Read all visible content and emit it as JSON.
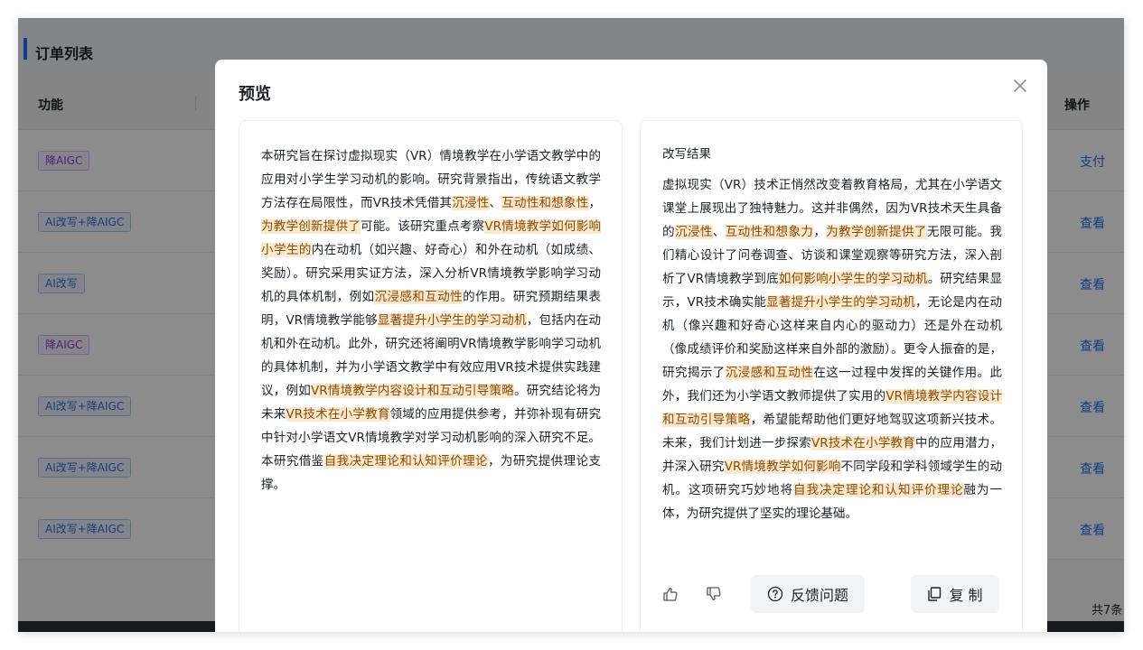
{
  "app": {
    "title": "订单列表",
    "columns": {
      "function": "功能",
      "operation": "操作"
    },
    "rows": [
      {
        "tag": "降AIGC",
        "tag_color": "purple",
        "action": "支付"
      },
      {
        "tag": "AI改写+降AIGC",
        "tag_color": "blue",
        "action": "查看"
      },
      {
        "tag": "AI改写",
        "tag_color": "blue",
        "action": "查看"
      },
      {
        "tag": "降AIGC",
        "tag_color": "purple",
        "action": "查看"
      },
      {
        "tag": "AI改写+降AIGC",
        "tag_color": "blue",
        "action": "查看"
      },
      {
        "tag": "AI改写+降AIGC",
        "tag_color": "blue",
        "action": "查看"
      },
      {
        "tag": "AI改写+降AIGC",
        "tag_color": "blue",
        "action": "查看"
      }
    ],
    "total_text": "共7条"
  },
  "modal": {
    "title": "预览",
    "original_segments": [
      {
        "t": "本研究旨在探讨虚拟现实（VR）情境教学在小学语文教学中的应用对小学生学习动机的影响。研究背景指出，传统语文教学方法存在局限性，而VR技术凭借其",
        "h": false
      },
      {
        "t": "沉浸性",
        "h": true
      },
      {
        "t": "、",
        "h": false
      },
      {
        "t": "互动性和想象性",
        "h": true
      },
      {
        "t": "，",
        "h": false
      },
      {
        "t": "为教学创新提供了",
        "h": true
      },
      {
        "t": "可能。该研究重点考察",
        "h": false
      },
      {
        "t": "VR情境教学如何影响小学生的",
        "h": true
      },
      {
        "t": "内在动机（如兴趣、好奇心）和外在动机（如成绩、奖励）。研究采用实证方法，深入分析VR情境教学影响学习动机的具体机制，例如",
        "h": false
      },
      {
        "t": "沉浸感和互动性",
        "h": true
      },
      {
        "t": "的作用。研究预期结果表明，VR情境教学能够",
        "h": false
      },
      {
        "t": "显著提升小学生的学习动机",
        "h": true
      },
      {
        "t": "，包括内在动机和外在动机。此外，研究还将阐明VR情境教学影响学习动机的具体机制，并为小学语文教学中有效应用VR技术提供实践建议，例如",
        "h": false
      },
      {
        "t": "VR情境教学内容设计和互动引导策略",
        "h": true
      },
      {
        "t": "。研究结论将为未来",
        "h": false
      },
      {
        "t": "VR技术在小学教育",
        "h": true
      },
      {
        "t": "领域的应用提供参考，并弥补现有研究中针对小学语文VR情境教学对学习动机影响的深入研究不足。本研究借鉴",
        "h": false
      },
      {
        "t": "自我决定理论和认知评价理论",
        "h": true
      },
      {
        "t": "，为研究提供理论支撑。",
        "h": false
      }
    ],
    "result_label": "改写结果",
    "rewritten_segments": [
      {
        "t": "虚拟现实（VR）技术正悄然改变着教育格局，尤其在小学语文课堂上展现出了独特魅力。这并非偶然，因为VR技术天生具备的",
        "h": false
      },
      {
        "t": "沉浸性",
        "h": true
      },
      {
        "t": "、",
        "h": false
      },
      {
        "t": "互动性和想象力",
        "h": true
      },
      {
        "t": "，",
        "h": false
      },
      {
        "t": "为教学创新提供了",
        "h": true
      },
      {
        "t": "无限可能。我们精心设计了问卷调查、访谈和课堂观察等研究方法，深入剖析了VR情境教学到底",
        "h": false
      },
      {
        "t": "如何影响小学生的学习动机",
        "h": true
      },
      {
        "t": "。研究结果显示，VR技术确实能",
        "h": false
      },
      {
        "t": "显著提升小学生的学习动机",
        "h": true
      },
      {
        "t": "，无论是内在动机（像兴趣和好奇心这样来自内心的驱动力）还是外在动机（像成绩评价和奖励这样来自外部的激励）。更令人振奋的是，研究揭示了",
        "h": false
      },
      {
        "t": "沉浸感和互动性",
        "h": true
      },
      {
        "t": "在这一过程中发挥的关键作用。此外，我们还为小学语文教师提供了实用的",
        "h": false
      },
      {
        "t": "VR情境教学内容设计和互动引导策略",
        "h": true
      },
      {
        "t": "，希望能帮助他们更好地驾驭这项新兴技术。未来，我们计划进一步探索",
        "h": false
      },
      {
        "t": "VR技术在小学教育",
        "h": true
      },
      {
        "t": "中的应用潜力，并深入研究",
        "h": false
      },
      {
        "t": "VR情境教学如何影响",
        "h": true
      },
      {
        "t": "不同学段和学科领域学生的动机。这项研究巧妙地将",
        "h": false
      },
      {
        "t": "自我决定理论和认知评价理论",
        "h": true
      },
      {
        "t": "融为一体，为研究提供了坚实的理论基础。",
        "h": false
      }
    ],
    "feedback_label": "反馈问题",
    "copy_label": "复 制"
  },
  "colors": {
    "accent": "#1f6ff2",
    "highlight_bg": "#fde9cf",
    "highlight_text": "#8a4a00"
  }
}
